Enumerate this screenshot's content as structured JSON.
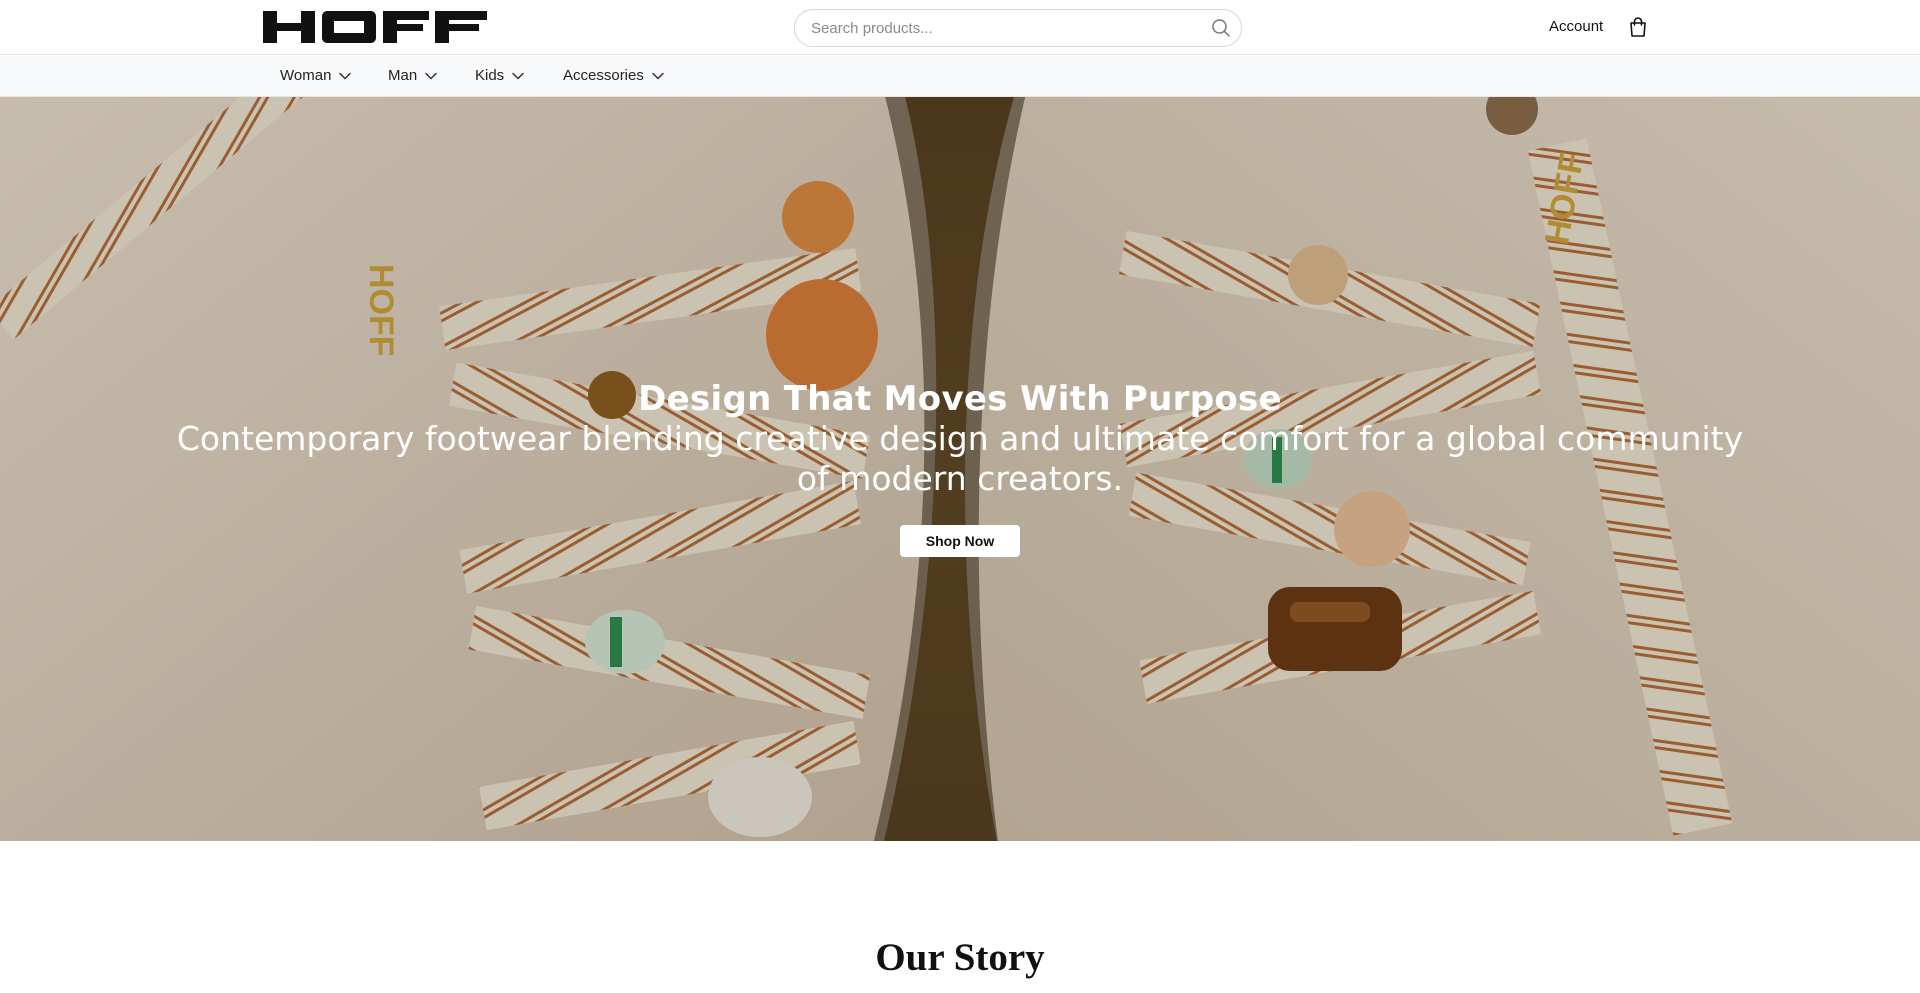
{
  "brand": {
    "logo_text": "HOFF"
  },
  "search": {
    "placeholder": "Search products..."
  },
  "header": {
    "account_label": "Account"
  },
  "nav": {
    "items": [
      {
        "label": "Woman"
      },
      {
        "label": "Man"
      },
      {
        "label": "Kids"
      },
      {
        "label": "Accessories"
      }
    ]
  },
  "hero": {
    "title": "Design That Moves With Purpose",
    "subtitle": "Contemporary footwear blending creative design and ultimate comfort for a global community of modern creators.",
    "cta_label": "Shop Now",
    "image_text": "HOFF"
  },
  "story": {
    "title": "Our Story"
  },
  "colors": {
    "background": "#ffffff",
    "nav_background": "#f8f9fb",
    "text": "#111111",
    "hero_text": "#ffffff"
  },
  "icons": {
    "search": "search-icon",
    "cart": "shopping-bag-icon",
    "nav_dropdown": "chevron-down-icon"
  }
}
